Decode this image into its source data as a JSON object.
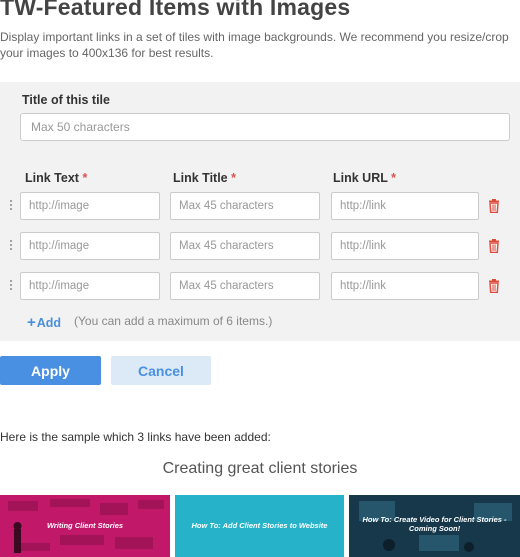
{
  "header": {
    "title": "TW-Featured Items with Images",
    "description": "Display important links in a set of tiles with image backgrounds. We recommend you resize/crop your images to 400x136 for best results."
  },
  "form": {
    "tile_title_label": "Title of this tile",
    "tile_title_placeholder": "Max 50 characters",
    "tile_title_value": "",
    "columns": {
      "link_text": "Link Text",
      "link_title": "Link Title",
      "link_url": "Link URL",
      "required_mark": "*"
    },
    "rows": [
      {
        "text_placeholder": "http://image",
        "title_placeholder": "Max 45 characters",
        "url_placeholder": "http://link"
      },
      {
        "text_placeholder": "http://image",
        "title_placeholder": "Max 45 characters",
        "url_placeholder": "http://link"
      },
      {
        "text_placeholder": "http://image",
        "title_placeholder": "Max 45 characters",
        "url_placeholder": "http://link"
      }
    ],
    "add_label": "Add",
    "add_hint": "(You can add a maximum of 6 items.)"
  },
  "actions": {
    "apply_label": "Apply",
    "cancel_label": "Cancel"
  },
  "sample": {
    "intro": "Here is the sample which 3 links have been added:",
    "heading": "Creating great client stories",
    "tiles": [
      {
        "label": "Writing Client Stories"
      },
      {
        "label": "How To: Add Client Stories to Website"
      },
      {
        "label": "How To: Create Video for Client Stories - Coming Soon!"
      }
    ]
  },
  "colors": {
    "primary": "#4a90e2",
    "required": "#d9534f",
    "tile_1": "#c2186a",
    "tile_2": "#26b3c9",
    "tile_3": "#17384a"
  }
}
